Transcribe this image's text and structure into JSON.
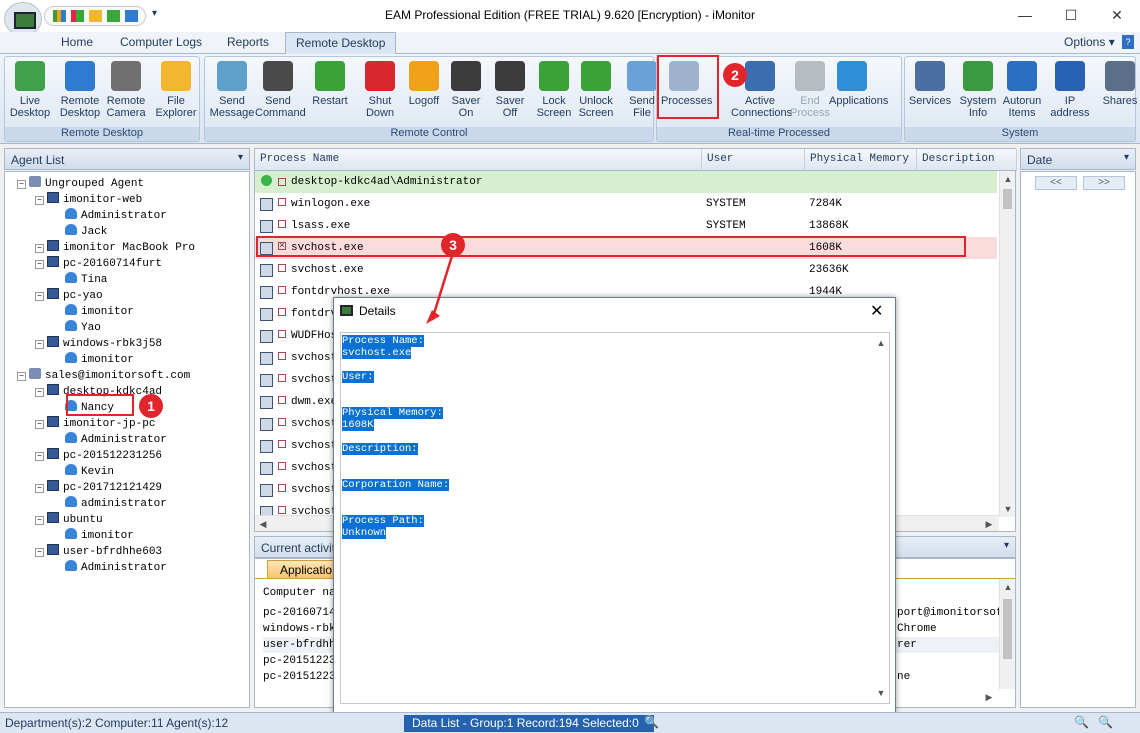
{
  "window": {
    "title": "EAM Professional Edition (FREE TRIAL) 9.620 [Encryption) - iMonitor"
  },
  "menu": {
    "tabs": [
      "Home",
      "Computer Logs",
      "Reports",
      "Remote Desktop"
    ],
    "active": "Remote Desktop",
    "options": "Options"
  },
  "ribbon": {
    "groups": [
      {
        "label": "Remote Desktop",
        "buttons": [
          {
            "label": "Live\nDesktop",
            "icon": "monitor-icon",
            "color": "#3fa24b"
          },
          {
            "label": "Remote\nDesktop",
            "icon": "desktop-icon",
            "color": "#2f7bd1"
          },
          {
            "label": "Remote\nCamera",
            "icon": "camera-icon",
            "color": "#707070"
          },
          {
            "label": "File\nExplorer",
            "icon": "folder-icon",
            "color": "#f2b630"
          }
        ]
      },
      {
        "label": "Remote Control",
        "buttons": [
          {
            "label": "Send\nMessage",
            "icon": "message-icon",
            "color": "#5fa0c8"
          },
          {
            "label": "Send\nCommand",
            "icon": "command-icon",
            "color": "#4a4a4a"
          },
          {
            "label": "Restart",
            "icon": "restart-icon",
            "color": "#3ba23a"
          },
          {
            "label": "Shut\nDown",
            "icon": "power-icon",
            "color": "#d9272e"
          },
          {
            "label": "Logoff",
            "icon": "key-icon",
            "color": "#f0a21a"
          },
          {
            "label": "Saver\nOn",
            "icon": "screensaver-on-icon",
            "color": "#3c3c3c"
          },
          {
            "label": "Saver\nOff",
            "icon": "screensaver-off-icon",
            "color": "#3c3c3c"
          },
          {
            "label": "Lock\nScreen",
            "icon": "lock-icon",
            "color": "#3ba23a"
          },
          {
            "label": "Unlock\nScreen",
            "icon": "unlock-icon",
            "color": "#3ba23a"
          },
          {
            "label": "Send\nFile",
            "icon": "send-file-icon",
            "color": "#6aa2d8"
          }
        ]
      },
      {
        "label": "Real-time Processed",
        "buttons": [
          {
            "label": "Processes",
            "icon": "processes-icon",
            "color": "#9fb3cc"
          },
          {
            "label": "Active\nConnections",
            "icon": "connections-icon",
            "color": "#3c6db0"
          },
          {
            "label": "End\nProcess",
            "icon": "end-process-icon",
            "color": "#b7bcc3",
            "disabled": true
          },
          {
            "label": "Applications",
            "icon": "applications-icon",
            "color": "#2e8fd6"
          }
        ]
      },
      {
        "label": "System",
        "buttons": [
          {
            "label": "Services",
            "icon": "services-icon",
            "color": "#4b6fa0"
          },
          {
            "label": "System\nInfo",
            "icon": "system-info-icon",
            "color": "#3a9a3f"
          },
          {
            "label": "Autorun\nItems",
            "icon": "autorun-icon",
            "color": "#2a6fc2"
          },
          {
            "label": "IP\naddress",
            "icon": "ip-icon",
            "color": "#2a62b3"
          },
          {
            "label": "Shares",
            "icon": "shares-icon",
            "color": "#5c6f8a"
          }
        ]
      }
    ]
  },
  "agent_panel": {
    "title": "Agent List",
    "tree": [
      {
        "label": "Ungrouped Agent",
        "type": "grp",
        "level": 0
      },
      {
        "label": "imonitor-web",
        "type": "pc",
        "level": 1
      },
      {
        "label": "Administrator",
        "type": "user",
        "level": 2
      },
      {
        "label": "Jack",
        "type": "user",
        "level": 2
      },
      {
        "label": "imonitor MacBook Pro",
        "type": "pc",
        "level": 1
      },
      {
        "label": "pc-20160714furt",
        "type": "pc",
        "level": 1
      },
      {
        "label": "Tina",
        "type": "user",
        "level": 2
      },
      {
        "label": "pc-yao",
        "type": "pc",
        "level": 1
      },
      {
        "label": "imonitor",
        "type": "user",
        "level": 2
      },
      {
        "label": "Yao",
        "type": "user",
        "level": 2
      },
      {
        "label": "windows-rbk3j58",
        "type": "pc",
        "level": 1
      },
      {
        "label": "imonitor",
        "type": "user",
        "level": 2
      },
      {
        "label": "sales@imonitorsoft.com",
        "type": "grp",
        "level": 0
      },
      {
        "label": "desktop-kdkc4ad",
        "type": "pc",
        "level": 1
      },
      {
        "label": "Nancy",
        "type": "user",
        "level": 2,
        "selected": true
      },
      {
        "label": "imonitor-jp-pc",
        "type": "pc",
        "level": 1
      },
      {
        "label": "Administrator",
        "type": "user",
        "level": 2
      },
      {
        "label": "pc-201512231256",
        "type": "pc",
        "level": 1
      },
      {
        "label": "Kevin",
        "type": "user",
        "level": 2
      },
      {
        "label": "pc-201712121429",
        "type": "pc",
        "level": 1
      },
      {
        "label": "administrator",
        "type": "user",
        "level": 2
      },
      {
        "label": "ubuntu",
        "type": "pc",
        "level": 1
      },
      {
        "label": "imonitor",
        "type": "user",
        "level": 2
      },
      {
        "label": "user-bfrdhhe603",
        "type": "pc",
        "level": 1
      },
      {
        "label": "Administrator",
        "type": "user",
        "level": 2
      }
    ]
  },
  "process_table": {
    "columns": [
      "Process Name",
      "User",
      "Physical Memory",
      "Description"
    ],
    "group_row": "desktop-kdkc4ad\\Administrator",
    "rows": [
      {
        "name": "winlogon.exe",
        "user": "SYSTEM",
        "mem": "7284K"
      },
      {
        "name": "lsass.exe",
        "user": "SYSTEM",
        "mem": "13868K"
      },
      {
        "name": "svchost.exe",
        "user": "",
        "mem": "1608K",
        "selected": true
      },
      {
        "name": "svchost.exe",
        "user": "",
        "mem": "23636K"
      },
      {
        "name": "fontdrvhost.exe",
        "user": "",
        "mem": "1944K"
      },
      {
        "name": "fontdrv",
        "user": "",
        "mem": ""
      },
      {
        "name": "WUDFHos",
        "user": "",
        "mem": ""
      },
      {
        "name": "svchost",
        "user": "",
        "mem": ""
      },
      {
        "name": "svchost",
        "user": "",
        "mem": ""
      },
      {
        "name": "dwm.exe",
        "user": "",
        "mem": ""
      },
      {
        "name": "svchost",
        "user": "",
        "mem": ""
      },
      {
        "name": "svchost",
        "user": "",
        "mem": ""
      },
      {
        "name": "svchost",
        "user": "",
        "mem": ""
      },
      {
        "name": "svchost",
        "user": "",
        "mem": ""
      },
      {
        "name": "svchost",
        "user": "",
        "mem": ""
      }
    ]
  },
  "date_panel": {
    "title": "Date",
    "prev": "<<",
    "next": ">>"
  },
  "activities": {
    "title": "Current activiti",
    "tab": "Applicatio",
    "header": "Computer nam",
    "rows": [
      "pc-20160714.",
      "windows-rbk.",
      "user-bfrdhh.",
      "pc-20151223.",
      "pc-20151223."
    ],
    "right_rows": [
      "port@imonitorsoft",
      "Chrome",
      "rer",
      "",
      "ne"
    ]
  },
  "dialog": {
    "title": "Details",
    "lines": [
      "Process Name:",
      "svchost.exe",
      "",
      "User:",
      "",
      "",
      "Physical Memory:",
      "1608K",
      "",
      "Description:",
      "",
      "",
      "Corporation Name:",
      "",
      "",
      "Process Path:",
      "Unknown"
    ]
  },
  "status": {
    "left": "Department(s):2  Computer:11  Agent(s):12",
    "right": "Data List - Group:1  Record:194  Selected:0"
  },
  "annotations": [
    "1",
    "2",
    "3"
  ],
  "colors": {
    "accent_red": "#e0262b",
    "selection_blue": "#0b72d4",
    "group_row_green": "#d6f0cf"
  }
}
